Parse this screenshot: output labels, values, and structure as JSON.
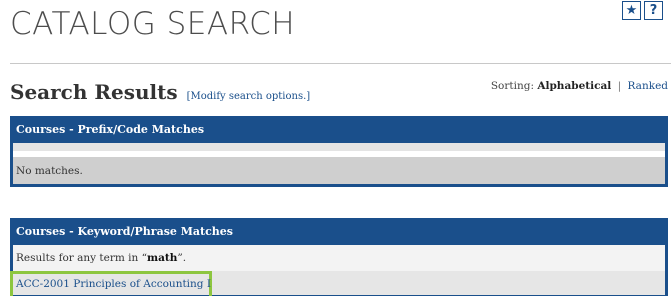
{
  "header": {
    "title": "CATALOG SEARCH",
    "icons": [
      {
        "name": "star-icon",
        "glyph": "★"
      },
      {
        "name": "help-icon",
        "glyph": "?"
      }
    ]
  },
  "results": {
    "heading": "Search Results",
    "modify_link": "[Modify search options.]",
    "sorting_label": "Sorting:",
    "sorting_active": "Alphabetical",
    "sorting_separator": "|",
    "sorting_alt": "Ranked"
  },
  "prefix_panel": {
    "title": "Courses - Prefix/Code Matches",
    "message": "No matches."
  },
  "keyword_panel": {
    "title": "Courses - Keyword/Phrase Matches",
    "results_prefix": "Results for any term in “",
    "term": "math",
    "results_suffix": "”.",
    "items": [
      "ACC-2001 Principles of Accounting I"
    ]
  },
  "colors": {
    "panel_header": "#1a4f8b",
    "link": "#1a4f8b",
    "highlight": "#8dc63f"
  }
}
